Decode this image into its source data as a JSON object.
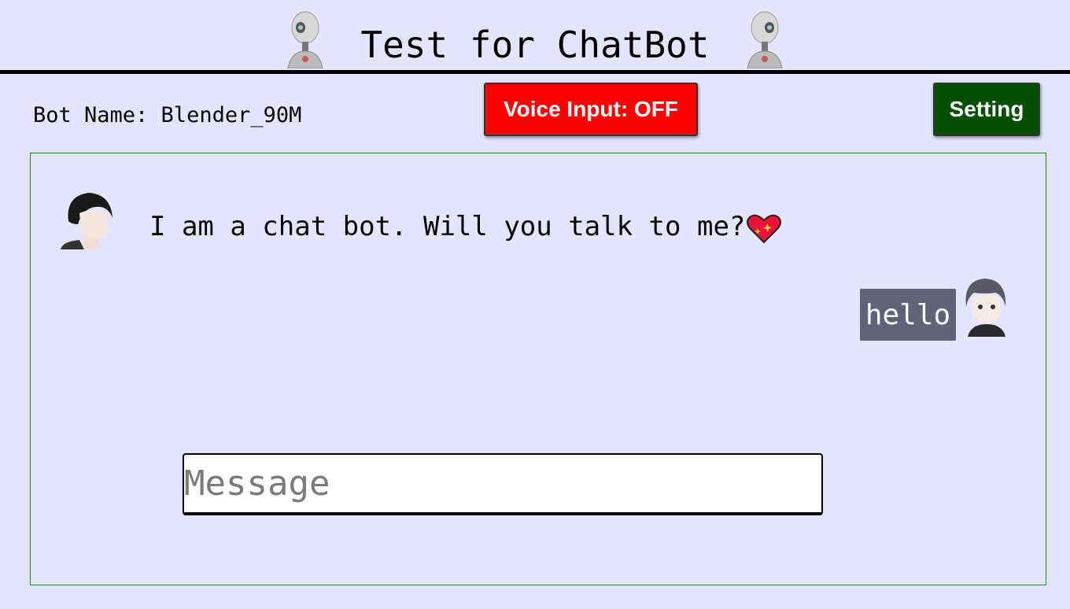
{
  "header": {
    "title": "Test for ChatBot",
    "left_icon": "robot-icon",
    "right_icon": "robot-icon"
  },
  "toolbar": {
    "bot_name_label": "Bot Name: Blender_90M",
    "voice_button_label": "Voice Input: OFF",
    "setting_button_label": "Setting"
  },
  "chat": {
    "messages": [
      {
        "sender": "bot",
        "text": "I am a chat bot. Will you talk to me?",
        "emoji": "sparkling-heart-icon",
        "avatar": "bot-avatar"
      },
      {
        "sender": "user",
        "text": "hello",
        "avatar": "user-avatar"
      }
    ],
    "input": {
      "placeholder": "Message",
      "value": ""
    }
  },
  "colors": {
    "background": "#e4e5fc",
    "voice_button": "#fe0000",
    "setting_button": "#005000",
    "user_bubble": "#606278",
    "panel_border": "#1a8a1a"
  }
}
